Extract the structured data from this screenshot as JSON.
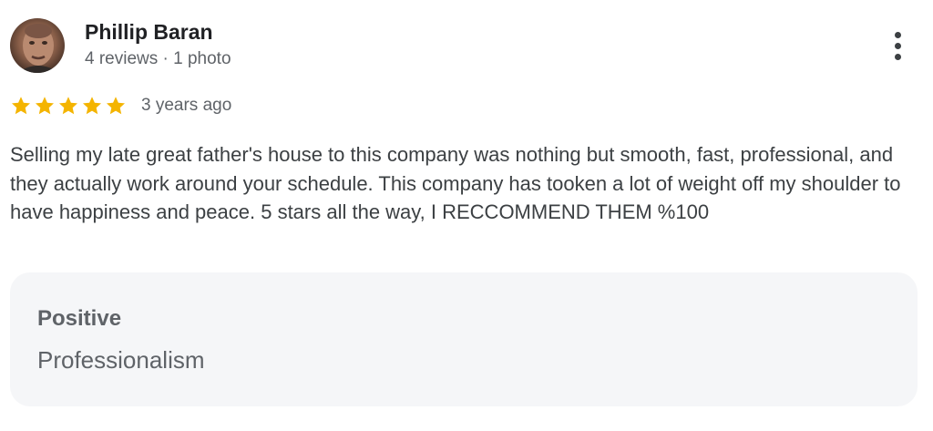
{
  "reviewer": {
    "name": "Phillip Baran",
    "meta": "4 reviews · 1 photo",
    "avatar_icon": "person-photo"
  },
  "rating": {
    "stars": 5,
    "max_stars": 5,
    "star_color": "#f4b400",
    "time_ago": "3 years ago"
  },
  "review": {
    "text": "Selling my late great father's house to this company was nothing but smooth, fast, professional, and they actually work around your schedule. This company has tooken a lot of weight off my shoulder to have happiness and peace. 5 stars all the way, I RECCOMMEND THEM %100"
  },
  "aspect": {
    "label": "Positive",
    "value": "Professionalism"
  },
  "menu": {
    "icon": "more-vert-icon"
  }
}
